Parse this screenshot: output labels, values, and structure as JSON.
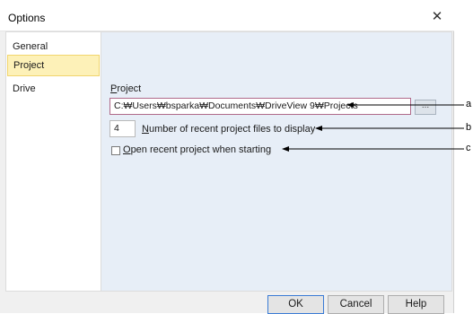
{
  "window": {
    "title": "Options",
    "close_glyph": "✕"
  },
  "sidebar": {
    "items": [
      {
        "label": "General",
        "selected": false
      },
      {
        "label": "Project",
        "selected": true
      },
      {
        "label": "Drive",
        "selected": false
      }
    ]
  },
  "project": {
    "section_label_first": "P",
    "section_label_rest": "roject",
    "path_value": "C:₩Users₩bsparka₩Documents₩DriveView 9₩Projects",
    "browse_label": "...",
    "recent_count": "4",
    "recent_label_first": "N",
    "recent_label_rest": "umber of recent project files to display",
    "open_recent_first": "O",
    "open_recent_rest": "pen recent project when starting",
    "open_recent_checked": false
  },
  "buttons": {
    "ok": "OK",
    "cancel": "Cancel",
    "help": "Help"
  },
  "annotations": {
    "a": "a",
    "b": "b",
    "c": "c"
  }
}
